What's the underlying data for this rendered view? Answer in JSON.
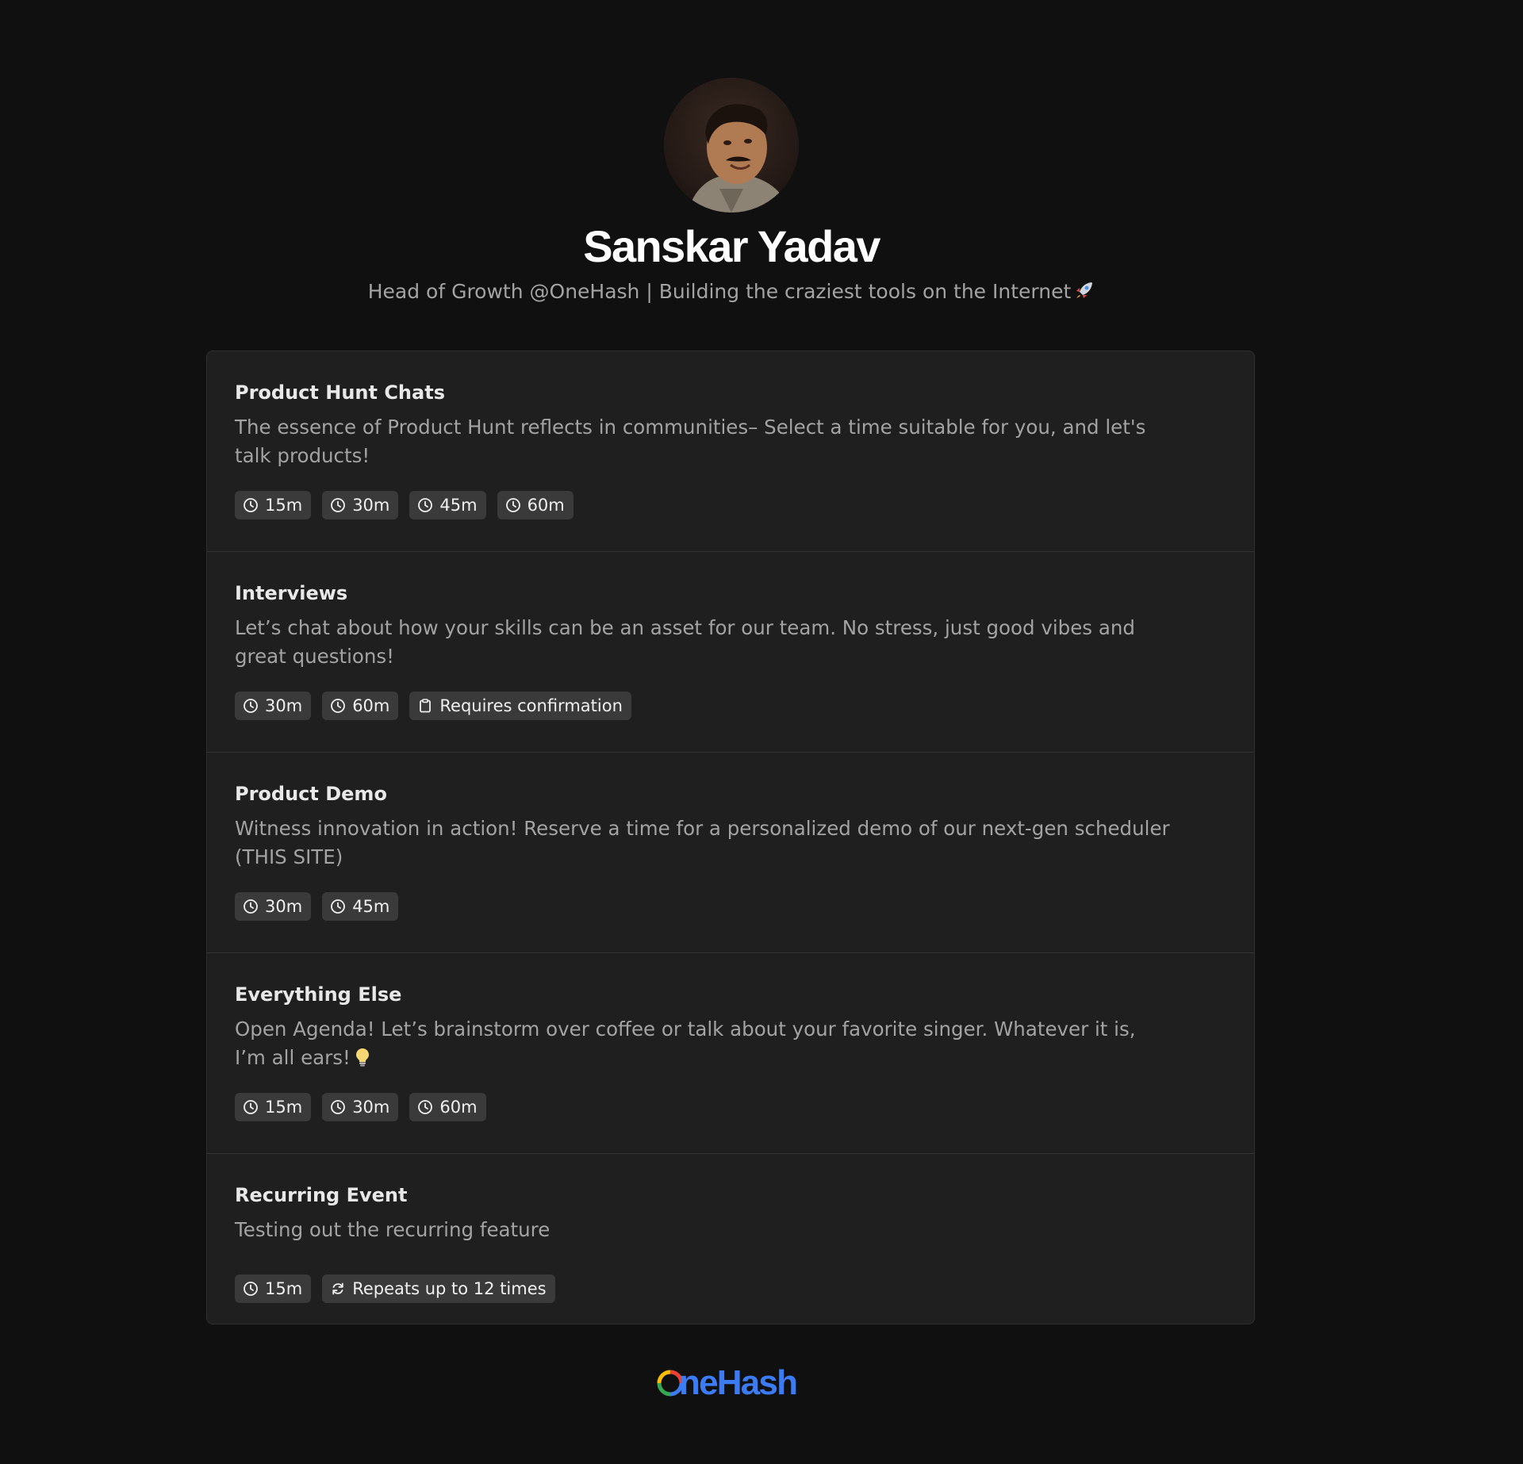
{
  "profile": {
    "name": "Sanskar Yadav",
    "bio": "Head of Growth @OneHash | Building the craziest tools on the Internet",
    "bio_emoji": "rocket"
  },
  "events": [
    {
      "title": "Product Hunt Chats",
      "description": "The essence of Product Hunt reflects in communities– Select a time suitable for you, and let's talk products!",
      "badges": [
        {
          "icon": "clock-icon",
          "label": "15m"
        },
        {
          "icon": "clock-icon",
          "label": "30m"
        },
        {
          "icon": "clock-icon",
          "label": "45m"
        },
        {
          "icon": "clock-icon",
          "label": "60m"
        }
      ]
    },
    {
      "title": "Interviews",
      "description": "Let’s chat about how your skills can be an asset for our team. No stress, just good vibes and great questions!",
      "badges": [
        {
          "icon": "clock-icon",
          "label": "30m"
        },
        {
          "icon": "clock-icon",
          "label": "60m"
        },
        {
          "icon": "clipboard-icon",
          "label": "Requires confirmation"
        }
      ]
    },
    {
      "title": "Product Demo",
      "description": "Witness innovation in action! Reserve a time for a personalized demo of our next-gen scheduler (THIS SITE)",
      "badges": [
        {
          "icon": "clock-icon",
          "label": "30m"
        },
        {
          "icon": "clock-icon",
          "label": "45m"
        }
      ]
    },
    {
      "title": "Everything Else",
      "description": "Open Agenda! Let’s brainstorm over coffee or talk about your favorite singer. Whatever it is, I’m all ears!",
      "description_emoji": "lightbulb",
      "badges": [
        {
          "icon": "clock-icon",
          "label": "15m"
        },
        {
          "icon": "clock-icon",
          "label": "30m"
        },
        {
          "icon": "clock-icon",
          "label": "60m"
        }
      ]
    },
    {
      "title": "Recurring Event",
      "description": "Testing out the recurring feature",
      "badges": [
        {
          "icon": "clock-icon",
          "label": "15m"
        },
        {
          "icon": "repeat-icon",
          "label": "Repeats up to 12 times"
        }
      ]
    }
  ],
  "footer": {
    "brand": "OneHash"
  },
  "colors": {
    "background": "#101010",
    "card": "#1f1f1f",
    "badge": "#3a3a3a",
    "brand_blue": "#3b7cf4"
  }
}
